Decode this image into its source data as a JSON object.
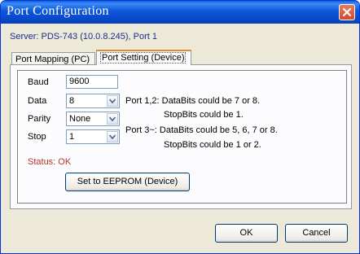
{
  "window": {
    "title": "Port Configuration"
  },
  "server": {
    "label": "Server: PDS-743 (10.0.8.245), Port 1"
  },
  "tabs": [
    {
      "label": "Port Mapping (PC)"
    },
    {
      "label": "Port Setting (Device)"
    }
  ],
  "fields": {
    "baud": {
      "label": "Baud",
      "value": "9600"
    },
    "data": {
      "label": "Data",
      "value": "8"
    },
    "parity": {
      "label": "Parity",
      "value": "None"
    },
    "stop": {
      "label": "Stop",
      "value": "1"
    }
  },
  "notes": {
    "line1": "Port 1,2: DataBits could be 7 or 8.",
    "line2": "StopBits could be 1.",
    "line3": "Port 3~: DataBits could be 5, 6, 7 or 8.",
    "line4": "StopBits could be 1 or 2."
  },
  "status": {
    "text": "Status: OK",
    "color": "#b4322c"
  },
  "buttons": {
    "eeprom": "Set to EEPROM (Device)",
    "ok": "OK",
    "cancel": "Cancel"
  },
  "icons": {
    "close": "close-icon",
    "dropdown": "chevron-down-icon"
  },
  "colors": {
    "titlebar": "#0d56d8",
    "close": "#d14a2b",
    "server": "#1a2f8c"
  }
}
